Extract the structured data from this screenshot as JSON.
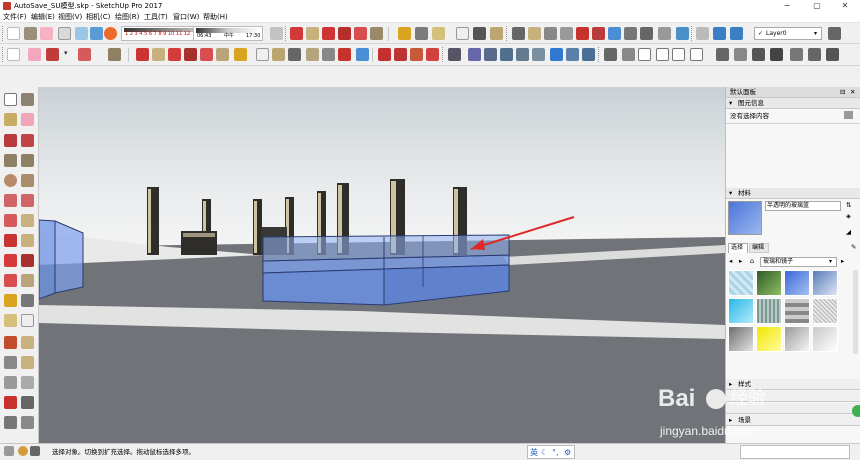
{
  "window": {
    "title": "AutoSave_SU模型.skp - SketchUp Pro 2017",
    "controls": {
      "minimize": "−",
      "maximize": "▢",
      "close": "✕"
    }
  },
  "menu": [
    "文件(F)",
    "编辑(E)",
    "视图(V)",
    "相机(C)",
    "绘图(R)",
    "工具(T)",
    "窗口(W)",
    "帮助(H)"
  ],
  "toolbar": {
    "scale_numbers": "1 2 3 4 5 6 7 8 9 10 11 12",
    "shadow_start": "06:43",
    "shadow_noon": "中午",
    "shadow_end": "17:30",
    "layer_name": "Layer0"
  },
  "tray": {
    "title": "默认面板",
    "entity_info": {
      "header": "图元信息",
      "status": "没有选择内容"
    },
    "materials": {
      "header": "材料",
      "material_name": "半透明的玻璃蓝",
      "tab_select": "选择",
      "tab_edit": "编辑",
      "library": "玻璃和镜子"
    },
    "collapsed_1": "样式",
    "collapsed_2": "场景"
  },
  "status": {
    "message": "选择对象。切换到扩充选择。拖动鼠标选择多项。"
  },
  "watermark": {
    "brand": "Bai",
    "brand_cn": "经验",
    "url": "jingyan.baidu.com"
  },
  "colors": {
    "glass_blue": "#6e93e6",
    "arrow_red": "#e02828",
    "ground": "#707479"
  }
}
